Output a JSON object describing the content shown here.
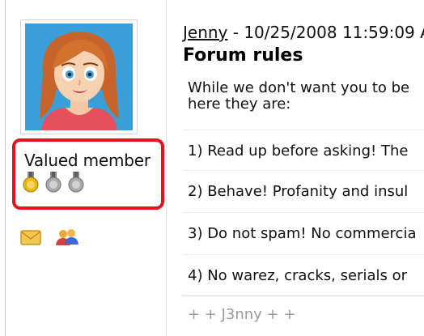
{
  "author": {
    "name": "Jenny",
    "rank_title": "Valued member",
    "medals": [
      {
        "icon": "gold-medal-icon",
        "color": "#e8b818"
      },
      {
        "icon": "silver-medal-icon",
        "color": "#a8a8a8"
      },
      {
        "icon": "silver-medal-icon",
        "color": "#a8a8a8"
      }
    ],
    "contact_icons": [
      "email-envelope-icon",
      "buddy-users-icon"
    ]
  },
  "post": {
    "date_sep": " - ",
    "timestamp": "10/25/2008 11:59:09 A",
    "title": "Forum rules",
    "intro_line1": "While we don't want you to be",
    "intro_line2": "here they are:",
    "rules": [
      "1) Read up before asking! The",
      "2) Behave! Profanity and insul",
      "3) Do not spam! No commercia",
      "4) No warez, cracks, serials or"
    ],
    "signature": "+ + J3nny + +"
  },
  "colors": {
    "highlight_border": "#e0161f",
    "avatar_background": "#3a9fd8",
    "signature_text": "#9a9a9a"
  }
}
